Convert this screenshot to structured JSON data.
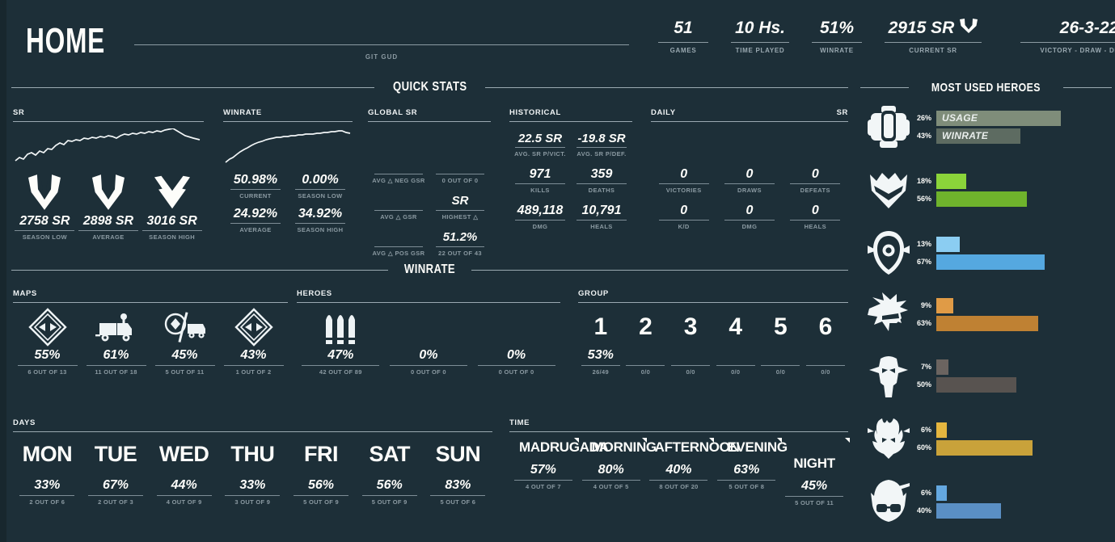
{
  "header": {
    "title": "HOME",
    "subtitle": "GIT GUD",
    "stats": [
      {
        "value": "51",
        "label": "GAMES"
      },
      {
        "value": "10 Hs.",
        "label": "TIME PLAYED"
      },
      {
        "value": "51%",
        "label": "WINRATE"
      },
      {
        "value": "2915 SR",
        "label": "CURRENT SR",
        "icon": "rank-wing-icon"
      },
      {
        "value": "26-3-22",
        "label": "VICTORY - DRAW - DEFEAT"
      }
    ]
  },
  "quick_stats": {
    "section_title": "QUICK STATS",
    "sr": {
      "label": "SR",
      "cells": [
        {
          "value": "2758 SR",
          "label": "SEASON LOW",
          "icon": "rank-wing-icon"
        },
        {
          "value": "2898 SR",
          "label": "AVERAGE",
          "icon": "rank-wing-icon"
        },
        {
          "value": "3016 SR",
          "label": "SEASON HIGH",
          "icon": "rank-chevron-icon"
        }
      ]
    },
    "winrate": {
      "label": "WINRATE",
      "cells": [
        {
          "value": "50.98%",
          "label": "CURRENT"
        },
        {
          "value": "0.00%",
          "label": "SEASON LOW"
        },
        {
          "value": "24.92%",
          "label": "AVERAGE"
        },
        {
          "value": "34.92%",
          "label": "SEASON HIGH"
        }
      ]
    },
    "global_sr": {
      "label": "GLOBAL SR",
      "cells": [
        {
          "value": "",
          "label": "AVG △ NEG GSR"
        },
        {
          "value": "",
          "label": "0 OUT OF 0"
        },
        {
          "value": "",
          "label": "AVG △ GSR"
        },
        {
          "value": "SR",
          "label": "HIGHEST △"
        },
        {
          "value": "",
          "label": "AVG △ POS GSR"
        },
        {
          "value": "51.2%",
          "label": "22 OUT OF 43"
        }
      ]
    },
    "historical": {
      "label": "HISTORICAL",
      "cells": [
        {
          "value": "22.5 SR",
          "label": "AVG. SR P/VICT."
        },
        {
          "value": "-19.8 SR",
          "label": "AVG. SR P/DEF."
        },
        {
          "value": "971",
          "label": "KILLS"
        },
        {
          "value": "359",
          "label": "DEATHS"
        },
        {
          "value": "489,118",
          "label": "DMG"
        },
        {
          "value": "10,791",
          "label": "HEALS"
        }
      ]
    },
    "daily": {
      "label": "DAILY",
      "label_right": "SR",
      "cells": [
        {
          "value": "0",
          "label": "VICTORIES"
        },
        {
          "value": "0",
          "label": "DRAWS"
        },
        {
          "value": "0",
          "label": "DEFEATS"
        },
        {
          "value": "0",
          "label": "K/D"
        },
        {
          "value": "0",
          "label": "DMG"
        },
        {
          "value": "0",
          "label": "HEALS"
        }
      ]
    }
  },
  "winrate_section": {
    "section_title": "WINRATE",
    "maps": {
      "label": "MAPS",
      "items": [
        {
          "icon": "assault-icon",
          "percent": "55%",
          "sub": "6 OUT OF 13"
        },
        {
          "icon": "escort-icon",
          "percent": "61%",
          "sub": "11 OUT OF 18"
        },
        {
          "icon": "hybrid-icon",
          "percent": "45%",
          "sub": "5 OUT OF 11"
        },
        {
          "icon": "assault-icon",
          "percent": "43%",
          "sub": "1 OUT OF 2"
        }
      ]
    },
    "heroes": {
      "label": "HEROES",
      "items": [
        {
          "icon": "role-damage-icon",
          "percent": "47%",
          "sub": "42 OUT OF 89"
        },
        {
          "icon": "",
          "percent": "0%",
          "sub": "0 OUT OF 0"
        },
        {
          "icon": "",
          "percent": "0%",
          "sub": "0 OUT OF 0"
        }
      ]
    },
    "group": {
      "label": "GROUP",
      "items": [
        {
          "name": "1",
          "percent": "53%",
          "sub": "26/49"
        },
        {
          "name": "2",
          "percent": "",
          "sub": "0/0"
        },
        {
          "name": "3",
          "percent": "",
          "sub": "0/0"
        },
        {
          "name": "4",
          "percent": "",
          "sub": "0/0"
        },
        {
          "name": "5",
          "percent": "",
          "sub": "0/0"
        },
        {
          "name": "6",
          "percent": "",
          "sub": "0/0"
        }
      ]
    },
    "days": {
      "label": "DAYS",
      "items": [
        {
          "name": "MON",
          "percent": "33%",
          "sub": "2 OUT OF 6"
        },
        {
          "name": "TUE",
          "percent": "67%",
          "sub": "2 OUT OF 3"
        },
        {
          "name": "WED",
          "percent": "44%",
          "sub": "4 OUT OF 9"
        },
        {
          "name": "THU",
          "percent": "33%",
          "sub": "3 OUT OF 9"
        },
        {
          "name": "FRI",
          "percent": "56%",
          "sub": "5 OUT OF 9"
        },
        {
          "name": "SAT",
          "percent": "56%",
          "sub": "5 OUT OF 9"
        },
        {
          "name": "SUN",
          "percent": "83%",
          "sub": "5 OUT OF 6"
        }
      ]
    },
    "time": {
      "label": "TIME",
      "items": [
        {
          "name": "MADRUGADA",
          "percent": "57%",
          "sub": "4 OUT OF 7"
        },
        {
          "name": "MORNING",
          "percent": "80%",
          "sub": "4 OUT OF 5"
        },
        {
          "name": "AFTERNOON",
          "percent": "40%",
          "sub": "8 OUT OF 20"
        },
        {
          "name": "EVENING",
          "percent": "63%",
          "sub": "5 OUT OF 8"
        },
        {
          "name": "NIGHT",
          "percent": "45%",
          "sub": "5 OUT OF 11"
        }
      ]
    }
  },
  "most_used_heroes": {
    "section_title": "MOST USED HEROES",
    "legend": {
      "usage": "USAGE",
      "winrate": "WINRATE"
    },
    "rows": [
      {
        "hero": "bastion-icon",
        "usage": "26%",
        "winrate": "43%",
        "usage_w": 154,
        "winrate_w": 104,
        "usage_color": "#7f8d7a",
        "winrate_color": "#5d6b61",
        "legend": true
      },
      {
        "hero": "genji-icon",
        "usage": "18%",
        "winrate": "56%",
        "usage_w": 37,
        "winrate_w": 112,
        "usage_color": "#8bd43a",
        "winrate_color": "#6fb32c"
      },
      {
        "hero": "zenyatta-icon",
        "usage": "13%",
        "winrate": "67%",
        "usage_w": 29,
        "winrate_w": 134,
        "usage_color": "#8bcdf2",
        "winrate_color": "#55a8e0"
      },
      {
        "hero": "tracer-icon",
        "usage": "9%",
        "winrate": "63%",
        "usage_w": 21,
        "winrate_w": 126,
        "usage_color": "#e09b46",
        "winrate_color": "#bf8133"
      },
      {
        "hero": "mccree-icon",
        "usage": "7%",
        "winrate": "50%",
        "usage_w": 15,
        "winrate_w": 99,
        "usage_color": "#6b6460",
        "winrate_color": "#585350"
      },
      {
        "hero": "junkrat-icon",
        "usage": "6%",
        "winrate": "60%",
        "usage_w": 13,
        "winrate_w": 119,
        "usage_color": "#e5b63f",
        "winrate_color": "#c9a23a"
      },
      {
        "hero": "mei-icon",
        "usage": "6%",
        "winrate": "40%",
        "usage_w": 13,
        "winrate_w": 80,
        "usage_color": "#64a8e0",
        "winrate_color": "#5a8fc4"
      }
    ]
  },
  "chart_data": [
    {
      "type": "line",
      "title": "SR",
      "y": [
        2758,
        2770,
        2762,
        2790,
        2800,
        2788,
        2812,
        2805,
        2828,
        2822,
        2845,
        2860,
        2848,
        2872,
        2866,
        2880,
        2874,
        2890,
        2884,
        2898,
        2892,
        2906,
        2900,
        2914,
        2908,
        2900,
        2918,
        2930,
        2922,
        2940,
        2934,
        2950,
        2944,
        2962,
        2956,
        2975,
        2968,
        2990,
        3005,
        3016,
        3000,
        2960,
        2940,
        2915
      ],
      "ylabel": "SR",
      "grid": false
    },
    {
      "type": "line",
      "title": "WINRATE",
      "y": [
        24.9,
        27.5,
        29.0,
        31.5,
        33.0,
        35.5,
        37.0,
        39.5,
        41.0,
        42.5,
        43.5,
        44.5,
        45.5,
        46.2,
        46.8,
        47.4,
        47.9,
        48.3,
        48.6,
        48.9,
        49.1,
        49.3,
        49.6,
        49.8,
        50.0,
        50.2,
        50.4,
        50.6,
        50.8,
        51.0,
        51.2,
        51.4,
        51.6,
        51.8,
        52.0,
        52.2,
        52.4,
        52.6,
        52.5,
        52.2,
        51.8,
        51.4,
        51.1,
        50.98
      ],
      "ylabel": "Winrate %",
      "grid": false
    }
  ]
}
